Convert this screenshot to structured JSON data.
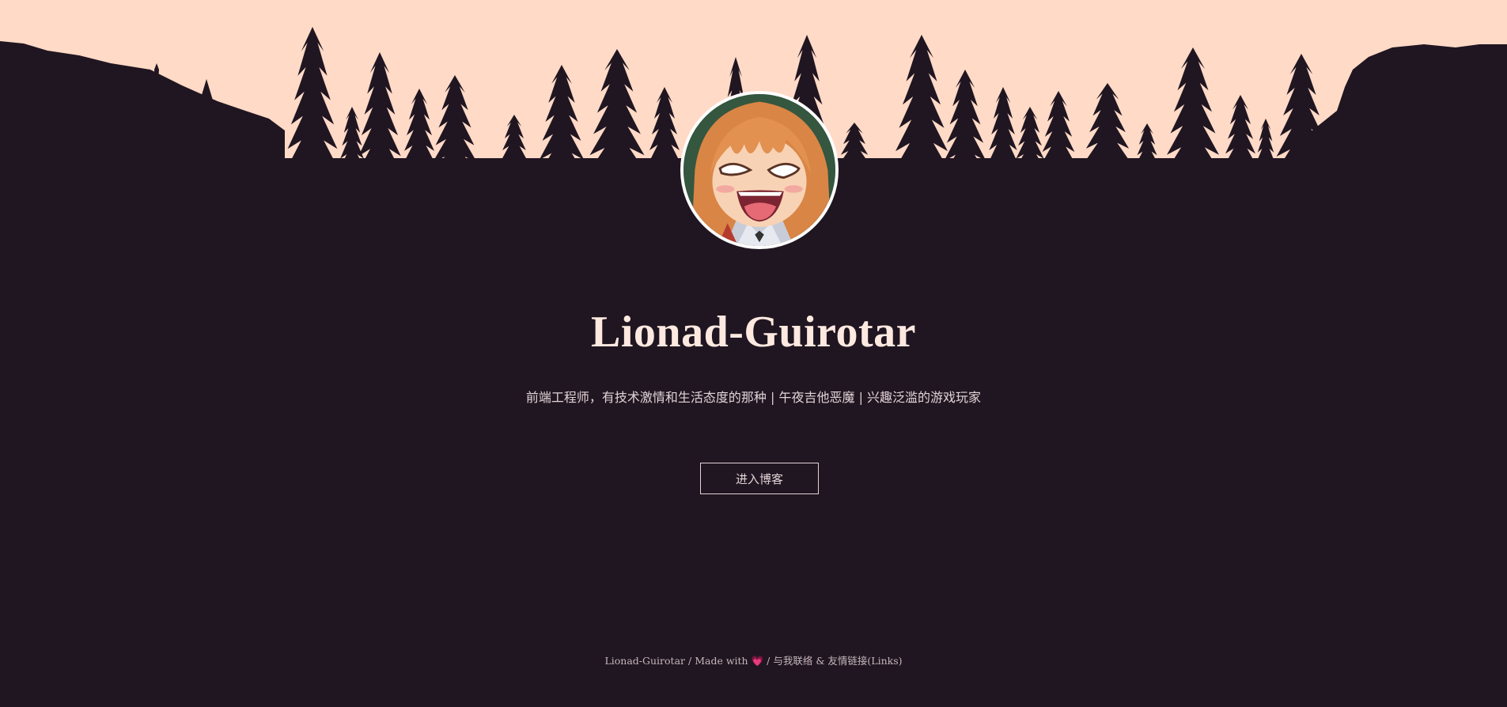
{
  "profile": {
    "name": "Lionad-Guirotar",
    "tagline": "前端工程师，有技术激情和生活态度的那种 | 午夜吉他恶魔 | 兴趣泛滥的游戏玩家",
    "avatar_icon": "anime-girl-avatar"
  },
  "actions": {
    "enter_blog_label": "进入博客"
  },
  "footer": {
    "author": "Lionad-Guirotar",
    "separator": "/",
    "made_with": "Made with",
    "heart": "💗",
    "contact_links": "与我联络 & 友情链接(Links)"
  },
  "colors": {
    "sky": "#ffdac7",
    "ground": "#201621",
    "title": "#fde9e0",
    "text": "#e2d2d6"
  }
}
